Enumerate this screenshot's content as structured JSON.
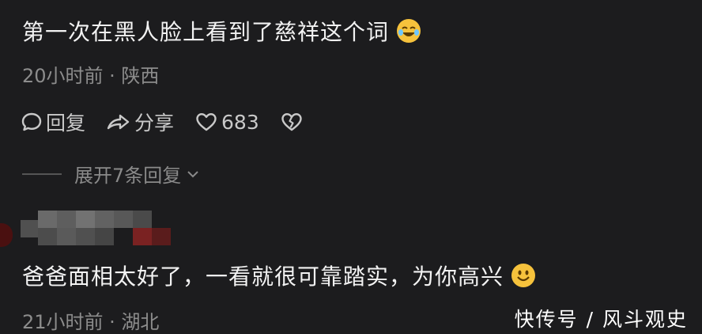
{
  "comments": [
    {
      "text": "第一次在黑人脸上看到了慈祥这个词",
      "emoji": "laughing-tears-emoji",
      "meta": "20小时前 · 陕西",
      "actions": {
        "reply_label": "回复",
        "share_label": "分享",
        "like_count": "683"
      },
      "replies_label": "展开7条回复"
    },
    {
      "text": "爸爸面相太好了，一看就很可靠踏实，为你高兴",
      "emoji": "smile-emoji",
      "meta": "21小时前 · 湖北"
    }
  ],
  "watermark": "快传号 / 风斗观史",
  "colors": {
    "background": "#1c1c1e",
    "text": "#f2f2f2",
    "muted": "#8c8c8c",
    "emoji": "#f6c23c"
  }
}
